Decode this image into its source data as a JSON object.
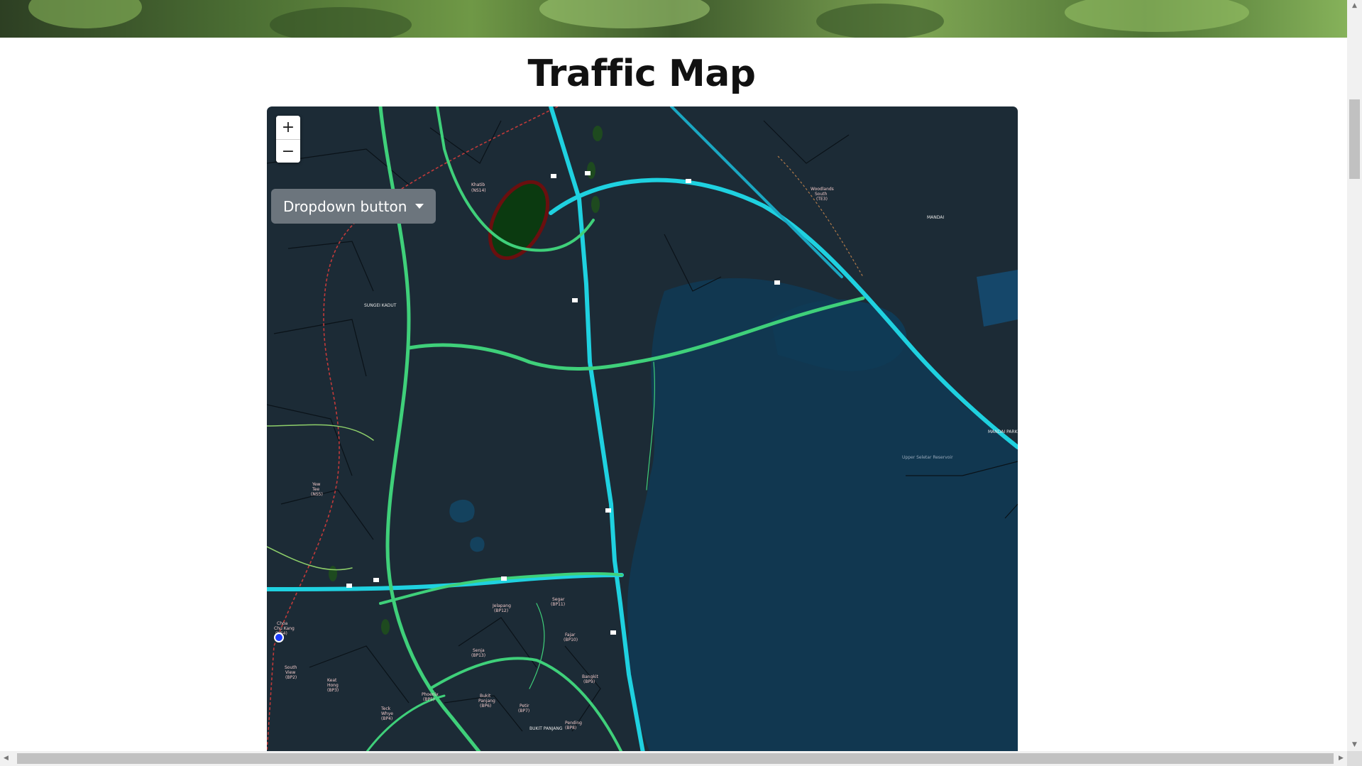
{
  "page": {
    "title": "Traffic Map"
  },
  "map": {
    "zoom_in_label": "+",
    "zoom_out_label": "−",
    "dropdown_label": "Dropdown button",
    "place_labels": [
      "Khatib (NS14)",
      "Yew Tee (NS5)",
      "Woodlands South (TE3)",
      "SUNGEI KADUT",
      "MANDAI",
      "Choa Chu Kang (NS4)",
      "South View (BP2)",
      "Keat Hong (BP3)",
      "Teck Whye (BP4)",
      "Phoenix (BP5)",
      "Bukit Panjang (BP6)",
      "Petir (BP7)",
      "Pending (BP8)",
      "Bangkit (BP9)",
      "Fajar (BP10)",
      "Segar (BP11)",
      "Jelapang (BP12)",
      "Senja (BP13)",
      "BUKIT PANJANG",
      "Upper Seletar Reservoir",
      "MANDAI PARK"
    ]
  },
  "colors": {
    "water": "#113750",
    "land": "#1c2b36",
    "road_fast": "#1fd1e0",
    "road_green": "#3fd07a",
    "rail": "#c23a3a",
    "dropdown_bg": "#6c757d"
  },
  "scrollbars": {
    "up": "▲",
    "down": "▼",
    "left": "◀",
    "right": "▶"
  }
}
